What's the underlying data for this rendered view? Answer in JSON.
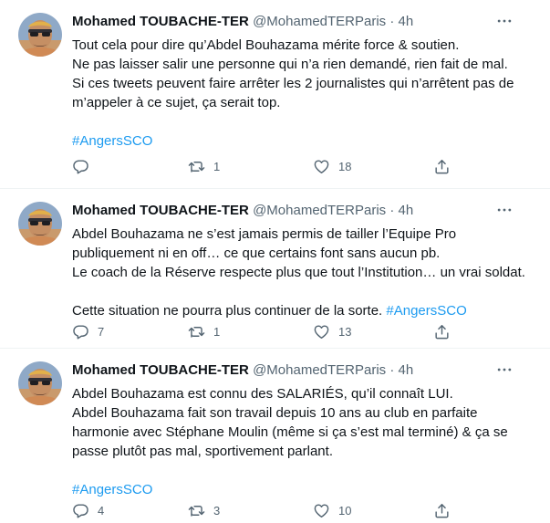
{
  "colors": {
    "accent": "#1d9bf0",
    "muted": "#536471",
    "text": "#0f1419",
    "divider": "#eff3f4"
  },
  "tweets": [
    {
      "author": {
        "name": "Mohamed TOUBACHE-TER",
        "handle": "@MohamedTERParis",
        "separator": "·",
        "time": "4h"
      },
      "lines": [
        "Tout cela pour dire qu’Abdel Bouhazama mérite force & soutien.",
        "Ne pas laisser salir une personne qui n’a rien demandé, rien fait de mal.",
        "Si ces tweets peuvent faire arrêter les 2 journalistes qui n’arrêtent pas de",
        "m’appeler à ce sujet, ça serait top."
      ],
      "hashtag": "#AngersSCO",
      "stats": {
        "replies": "",
        "retweets": "1",
        "likes": "18"
      }
    },
    {
      "author": {
        "name": "Mohamed TOUBACHE-TER",
        "handle": "@MohamedTERParis",
        "separator": "·",
        "time": "4h"
      },
      "lines": [
        "Abdel Bouhazama ne s’est jamais permis de tailler l’Equipe Pro",
        "publiquement ni en off… ce que certains font sans aucun pb.",
        "Le coach de la Réserve respecte plus que tout l’Institution… un vrai soldat."
      ],
      "last_line": "Cette situation ne pourra plus continuer de la sorte. ",
      "hashtag": "#AngersSCO",
      "stats": {
        "replies": "7",
        "retweets": "1",
        "likes": "13"
      }
    },
    {
      "author": {
        "name": "Mohamed TOUBACHE-TER",
        "handle": "@MohamedTERParis",
        "separator": "·",
        "time": "4h"
      },
      "lines": [
        "Abdel Bouhazama est connu des SALARIÉS, qu’il connaît LUI.",
        "Abdel Bouhazama fait son travail depuis 10 ans au club en parfaite",
        "harmonie avec Stéphane Moulin (même si ça s’est mal terminé) & ça se",
        "passe plutôt pas mal, sportivement parlant."
      ],
      "hashtag": "#AngersSCO",
      "stats": {
        "replies": "4",
        "retweets": "3",
        "likes": "10"
      }
    }
  ]
}
